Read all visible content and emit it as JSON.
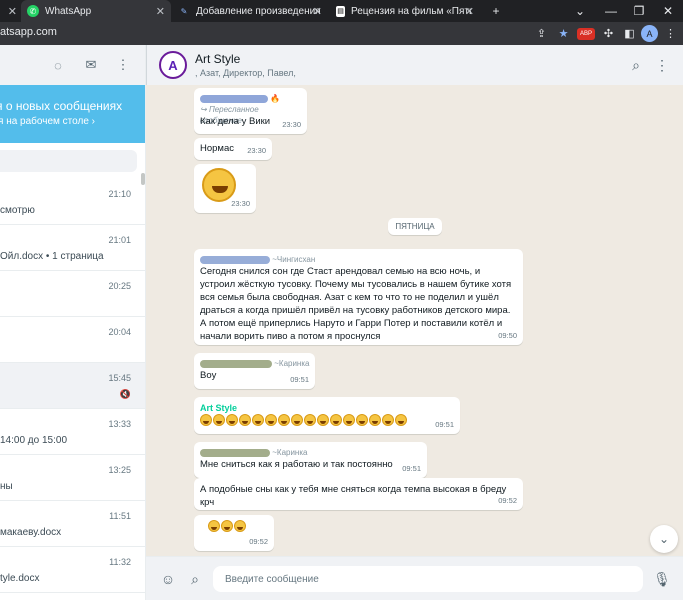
{
  "browser": {
    "tabs": [
      {
        "label": "",
        "active": false
      },
      {
        "label": "WhatsApp",
        "active": true
      },
      {
        "label": "Добавление произведения",
        "active": false
      },
      {
        "label": "Рецензия на фильм «Пятьдесят",
        "active": false
      }
    ],
    "new_tab": "+",
    "url": "atsapp.com",
    "window_controls": [
      "⌄",
      "—",
      "❐",
      "✕"
    ],
    "profile_initial": "A",
    "ext_badge": "ABP"
  },
  "left": {
    "notification": {
      "title": "я о новых сообщениях",
      "subtitle": "я на рабочем столе ›"
    },
    "chats": [
      {
        "time": "21:10",
        "preview": "смотрю"
      },
      {
        "time": "21:01",
        "preview": "Ойл.docx • 1 страница"
      },
      {
        "time": "20:25",
        "preview": ""
      },
      {
        "time": "20:04",
        "preview": ""
      },
      {
        "time": "15:45",
        "preview": "",
        "muted": true
      },
      {
        "time": "13:33",
        "preview": "14:00 до 15:00"
      },
      {
        "time": "13:25",
        "preview": "ны"
      },
      {
        "time": "11:51",
        "preview": "макаеву.docx"
      },
      {
        "time": "11:32",
        "preview": "tyle.docx"
      }
    ]
  },
  "chat": {
    "title": "Art Style",
    "members": ", Азат, Директор, Павел,",
    "avatar_letter": "A",
    "day_divider": "ПЯТНИЦА",
    "messages": [
      {
        "forwarded_label": "Пересланное сообщение",
        "text": "Как дела у Вики",
        "time": "23:30"
      },
      {
        "text": "Нормас",
        "time": "23:30"
      },
      {
        "time": "23:30"
      },
      {
        "sender_tail": "~Чингисхан",
        "text": "Сегодня снился сон где Стаст арендовал семью на всю ночь, и устроил жёсткую тусовку. Почему мы тусовались в нашем бутике хотя вся семья была свободная. Азат с кем то что то не поделил и ушёл драться а когда пришёл привёл на тусовку работников детского мира. А потом ещё приперлись Наруто и Гарри Потер и поставили котёл и начали ворить пиво а потом я проснулся",
        "time": "09:50"
      },
      {
        "sender_tail": "~Каринка",
        "text": "Boy",
        "time": "09:51"
      },
      {
        "sender": "Art Style",
        "time": "09:51"
      },
      {
        "sender_tail": "~Каринка",
        "text": "Мне сниться как я работаю и так постоянно",
        "time": "09:51"
      },
      {
        "text": "А подобные сны как у тебя мне сняться когда темпа высокая в бреду крч",
        "time": "09:52"
      },
      {
        "time": "09:52"
      }
    ],
    "composer_placeholder": "Введите сообщение"
  },
  "colors": {
    "accent": "#00a884",
    "blue": "#53bdeb",
    "bg": "#efeae2"
  }
}
